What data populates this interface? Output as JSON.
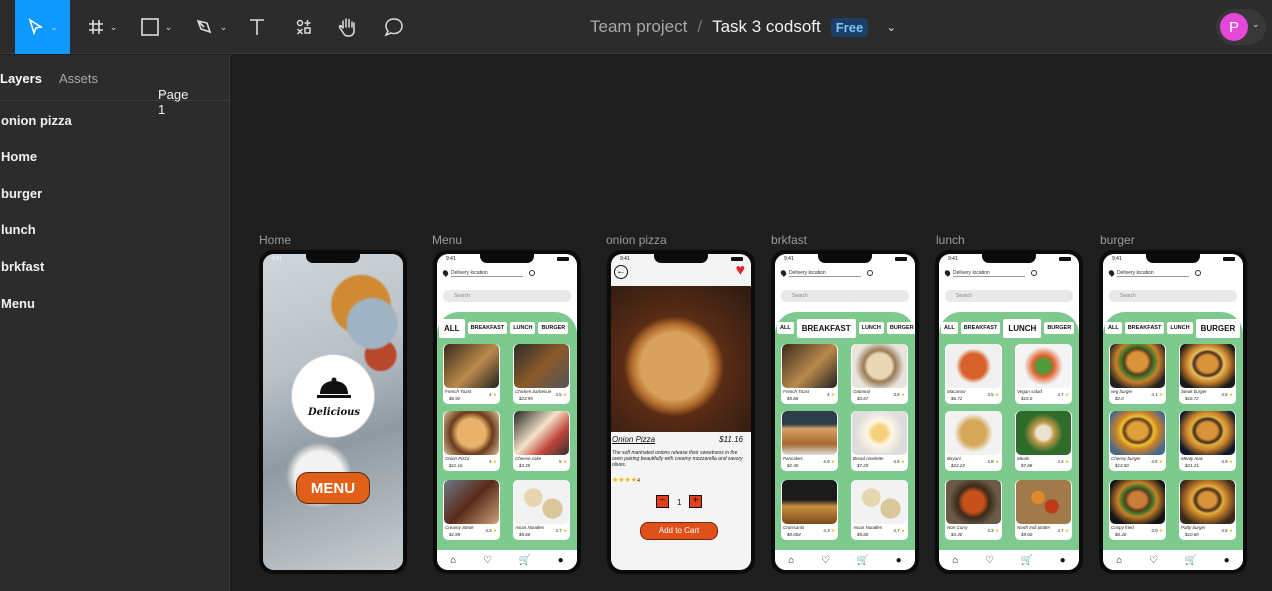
{
  "toolbar": {
    "project": "Team project",
    "separator": "/",
    "file": "Task 3 codsoft",
    "plan_badge": "Free",
    "avatar_initial": "P",
    "accent": "#0d99ff",
    "avatar_color": "#e548d8",
    "tools": [
      "move-icon",
      "frame-icon",
      "shape-icon",
      "pen-icon",
      "text-icon",
      "components-icon",
      "hand-icon",
      "comment-icon"
    ]
  },
  "panel": {
    "tab_layers": "Layers",
    "tab_assets": "Assets",
    "page": "Page 1",
    "layers": [
      "onion pizza",
      "Home",
      "burger",
      "lunch",
      "brkfast",
      "Menu"
    ]
  },
  "frames": {
    "labels": [
      "Home",
      "Menu",
      "onion pizza",
      "brkfast",
      "lunch",
      "burger"
    ],
    "time": "9:41",
    "delivery": "Delivery location",
    "search": "Search",
    "categories": [
      "ALL",
      "BREAKFAST",
      "LUNCH",
      "BURGER"
    ],
    "home_menu_button": "MENU",
    "home_logo": "Delicious",
    "menu_cards": [
      {
        "name": "French Toast",
        "price": "$6.92",
        "rating": "4"
      },
      {
        "name": "Chicken barbecue",
        "price": "$23.95",
        "rating": "4.5"
      },
      {
        "name": "Onion Pizza",
        "price": "$11.16",
        "rating": "4"
      },
      {
        "name": "Cheese cake",
        "price": "$3.25",
        "rating": "5"
      },
      {
        "name": "Creamy Steak",
        "price": "$1.89",
        "rating": "4.3"
      },
      {
        "name": "Asian Noodles",
        "price": "$5.60",
        "rating": "4.7"
      }
    ],
    "brk_cards": [
      {
        "name": "French Toast",
        "price": "$5.68",
        "rating": "4"
      },
      {
        "name": "Oatmeal",
        "price": "$3.67",
        "rating": "3.8"
      },
      {
        "name": "Pancakes",
        "price": "$2.30",
        "rating": "4.9"
      },
      {
        "name": "Bread omelette",
        "price": "$7.20",
        "rating": "4.5"
      },
      {
        "name": "Croissants",
        "price": "$0.004",
        "rating": "4.3"
      },
      {
        "name": "Asian Noodles",
        "price": "$5.60",
        "rating": "4.7"
      }
    ],
    "lunch_cards": [
      {
        "name": "Macaroni",
        "price": "$6.72",
        "rating": "3.5"
      },
      {
        "name": "Vegan salad",
        "price": "$15.0",
        "rating": "4.7"
      },
      {
        "name": "Biryani",
        "price": "$22.23",
        "rating": "4.8"
      },
      {
        "name": "Meals",
        "price": "$7.68",
        "rating": "4.2"
      },
      {
        "name": "Non Curry",
        "price": "$3.40",
        "rating": "4.3"
      },
      {
        "name": "North Indi platter",
        "price": "$9.60",
        "rating": "4.7"
      }
    ],
    "burger_cards": [
      {
        "name": "veg burger",
        "price": "$2.0",
        "rating": "4.1"
      },
      {
        "name": "Steak burger",
        "price": "$16.72",
        "rating": "4.5"
      },
      {
        "name": "Cheesy burger",
        "price": "$13.50",
        "rating": "4.5"
      },
      {
        "name": "Meaty mac",
        "price": "$21.21",
        "rating": "4.9"
      },
      {
        "name": "Crispy fried",
        "price": "$0.40",
        "rating": "3.9"
      },
      {
        "name": "Patty burger",
        "price": "$10.60",
        "rating": "4.5"
      }
    ],
    "pizza": {
      "title": "Onion Pizza",
      "price": "$11.16",
      "description": "The soft marinated onions release their sweetness in the oven pairing beautifully with creamy mozzarella and savory olives.",
      "rating": "4",
      "qty": "1",
      "add_to_cart": "Add to Cart"
    }
  }
}
